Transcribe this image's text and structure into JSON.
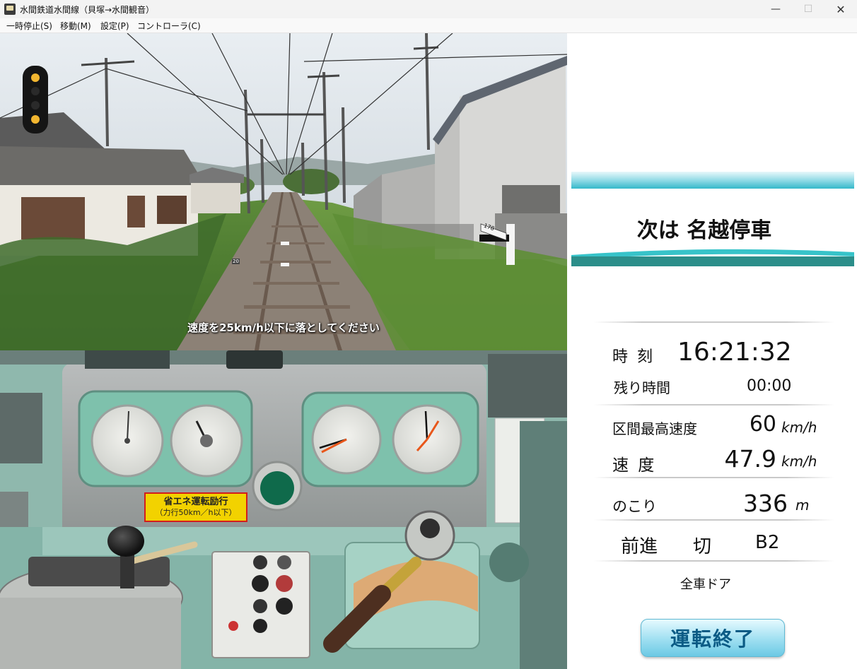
{
  "window": {
    "title": "水間鉄道水間線（貝塚→水間観音）",
    "minimize_glyph": "—",
    "maximize_glyph": "☐",
    "close_glyph": "✕"
  },
  "menu": {
    "items": [
      "一時停止(S)",
      "移動(M)",
      "設定(P)",
      "コントローラ(C)"
    ]
  },
  "scene": {
    "message": "速度を25km/h以下に落としてください",
    "signal_aspect": "yellow-yellow",
    "distance_post": "178",
    "track_sign": "20"
  },
  "cab": {
    "sticker_line1": "省エネ運転励行",
    "sticker_line2": "（力行50km／h以下）"
  },
  "panel": {
    "next_station": "次は 名越停車",
    "time_label": "時 刻",
    "time_value": "16:21:32",
    "remaining_label": "残り時間",
    "remaining_value": "00:00",
    "max_speed_label": "区間最高速度",
    "max_speed_value": "60",
    "max_speed_unit": "km/h",
    "speed_label": "速 度",
    "speed_value": "47.9",
    "speed_unit": "km/h",
    "distance_label": "のこり",
    "distance_value": "336",
    "distance_unit": "m",
    "reverser": "前進",
    "power_notch": "切",
    "brake_notch": "B2",
    "door_status": "全車ドア",
    "end_button": "運転終了"
  },
  "colors": {
    "banner_cyan": "#35b8c9",
    "banner_teal": "#2c8e8a",
    "button_text": "#0b5b85",
    "signal_lamp": "#f2b630"
  }
}
